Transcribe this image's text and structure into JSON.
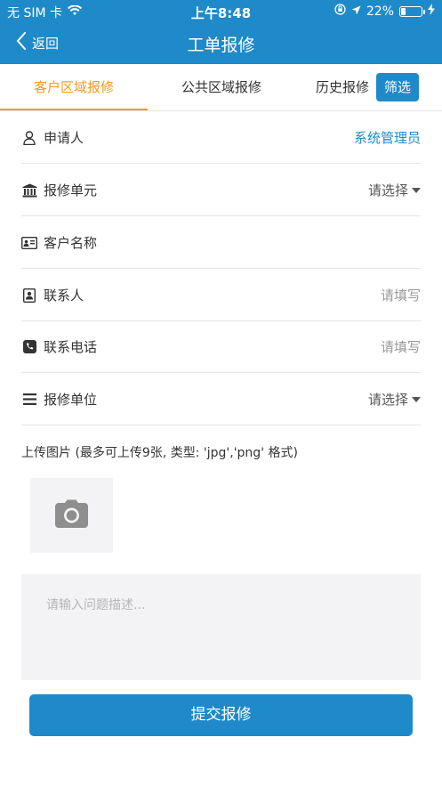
{
  "status_bar": {
    "carrier": "无 SIM 卡",
    "time": "上午8:48",
    "battery": "22%",
    "battery_level": 0.22
  },
  "nav": {
    "back_label": "返回",
    "title": "工单报修"
  },
  "tabs": [
    {
      "label": "客户区域报修",
      "active": true
    },
    {
      "label": "公共区域报修",
      "active": false
    },
    {
      "label": "历史报修",
      "active": false
    }
  ],
  "filter_label": "筛选",
  "form": {
    "applicant": {
      "label": "申请人",
      "value": "系统管理员",
      "icon": "user-icon"
    },
    "repair_unit": {
      "label": "报修单元",
      "value": "请选择",
      "icon": "bank-icon"
    },
    "customer_name": {
      "label": "客户名称",
      "value": "",
      "icon": "id-card-icon"
    },
    "contact": {
      "label": "联系人",
      "value": "请填写",
      "icon": "contact-book-icon"
    },
    "phone": {
      "label": "联系电话",
      "value": "请填写",
      "icon": "phone-icon"
    },
    "repair_place": {
      "label": "报修单位",
      "value": "请选择",
      "icon": "list-icon"
    }
  },
  "upload": {
    "label": "上传图片 (最多可上传9张, 类型: 'jpg','png' 格式)",
    "icon": "camera-icon"
  },
  "description": {
    "placeholder": "请输入问题描述..."
  },
  "submit_label": "提交报修",
  "colors": {
    "primary": "#1f8ac9",
    "accent": "#f39a21"
  }
}
